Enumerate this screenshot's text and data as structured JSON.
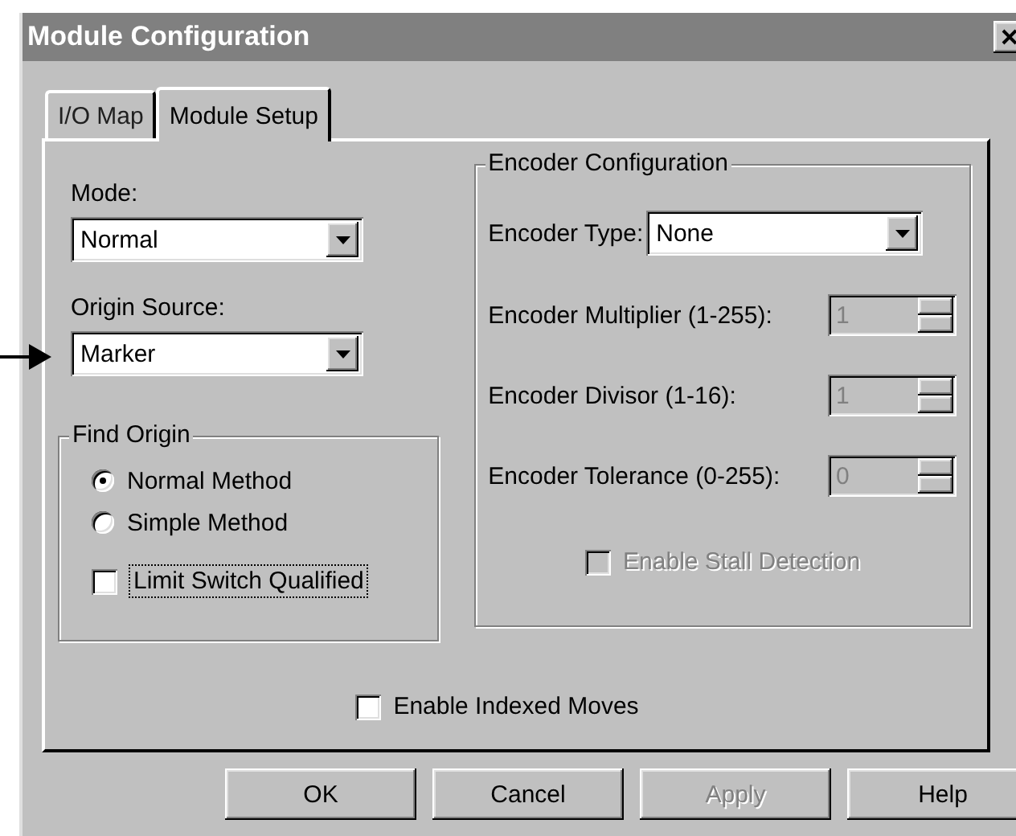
{
  "window": {
    "title": "Module Configuration"
  },
  "tabs": [
    {
      "label": "I/O Map",
      "selected": false
    },
    {
      "label": "Module Setup",
      "selected": true
    }
  ],
  "mode": {
    "label": "Mode:",
    "value": "Normal"
  },
  "origin_source": {
    "label": "Origin Source:",
    "value": "Marker"
  },
  "find_origin": {
    "title": "Find Origin",
    "options": [
      {
        "label": "Normal Method",
        "selected": true
      },
      {
        "label": "Simple Method",
        "selected": false
      }
    ],
    "limit_switch": {
      "label": "Limit Switch Qualified",
      "checked": false,
      "focused": true
    }
  },
  "encoder": {
    "title": "Encoder Configuration",
    "type": {
      "label": "Encoder Type:",
      "value": "None"
    },
    "fields": [
      {
        "label": "Encoder Multiplier (1-255):",
        "value": "1",
        "disabled": true
      },
      {
        "label": "Encoder Divisor (1-16):",
        "value": "1",
        "disabled": true
      },
      {
        "label": "Encoder Tolerance (0-255):",
        "value": "0",
        "disabled": true
      }
    ],
    "stall_detection": {
      "label": "Enable Stall Detection",
      "checked": false,
      "disabled": true
    }
  },
  "indexed_moves": {
    "label": "Enable Indexed Moves",
    "checked": false
  },
  "buttons": [
    {
      "label": "OK",
      "disabled": false
    },
    {
      "label": "Cancel",
      "disabled": false
    },
    {
      "label": "Apply",
      "disabled": true
    },
    {
      "label": "Help",
      "disabled": false
    }
  ]
}
